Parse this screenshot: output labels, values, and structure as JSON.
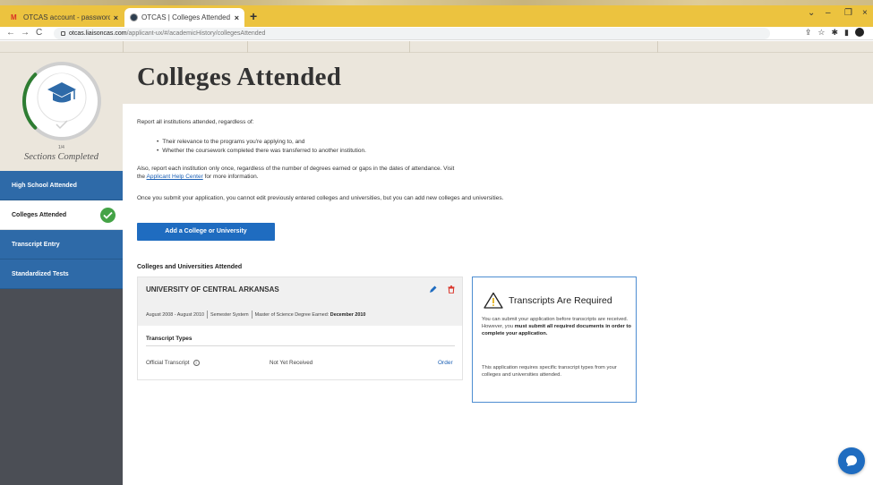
{
  "browser": {
    "tabs": [
      {
        "title": "OTCAS account - password reset",
        "active": false
      },
      {
        "title": "OTCAS | Colleges Attended Secti",
        "active": true
      }
    ],
    "new_tab": "+",
    "url_host": "otcas.liaisoncas.com",
    "url_path": "/applicant-ux/#/academicHistory/collegesAttended"
  },
  "sidebar": {
    "progress": {
      "completed": 1,
      "total": 4,
      "label": "1/4"
    },
    "sections_completed": "Sections Completed",
    "items": [
      {
        "label": "High School Attended",
        "active": false,
        "completed": false
      },
      {
        "label": "Colleges Attended",
        "active": true,
        "completed": true
      },
      {
        "label": "Transcript Entry",
        "active": false,
        "completed": false
      },
      {
        "label": "Standardized Tests",
        "active": false,
        "completed": false
      }
    ]
  },
  "page": {
    "title": "Colleges Attended",
    "intro": "Report all institutions attended, regardless of:",
    "bullets": [
      "Their relevance to the programs you're applying to, and",
      "Whether the coursework completed there was transferred to another institution."
    ],
    "also_text_1": "Also, report each institution only once, regardless of the number of degrees earned or gaps in the dates of attendance. Visit",
    "also_text_2_prefix": "the",
    "help_link": "Applicant Help Center",
    "also_text_2_suffix": "for more information.",
    "submit_note": "Once you submit your application, you cannot edit previously entered colleges and universities, but you can add new colleges and universities.",
    "add_button": "Add a College or University",
    "section_heading": "Colleges and Universities Attended"
  },
  "college": {
    "name": "UNIVERSITY OF CENTRAL ARKANSAS",
    "dates": "August 2008 - August 2010",
    "system": "Semester System",
    "degree_prefix": "Master of Science Degree Earned:",
    "degree_date": "December 2010",
    "transcript_types_label": "Transcript Types",
    "transcript": {
      "type": "Official Transcript",
      "info": "i",
      "status": "Not Yet Received",
      "action": "Order"
    }
  },
  "requirements": {
    "title": "Transcripts Are Required",
    "text_pre": "You can submit your application before transcripts are received. However, you",
    "text_bold": "must submit all required documents in order to complete your application.",
    "text2": "This application requires specific transcript types from your colleges and universities attended."
  },
  "colors": {
    "nav_blue": "#2e6aa8",
    "button_blue": "#1f6cc0",
    "header_beige": "#ebe6dc",
    "sidebar_dark": "#4b4e55",
    "check_green": "#44a346",
    "card_border": "#4d8dd1"
  }
}
